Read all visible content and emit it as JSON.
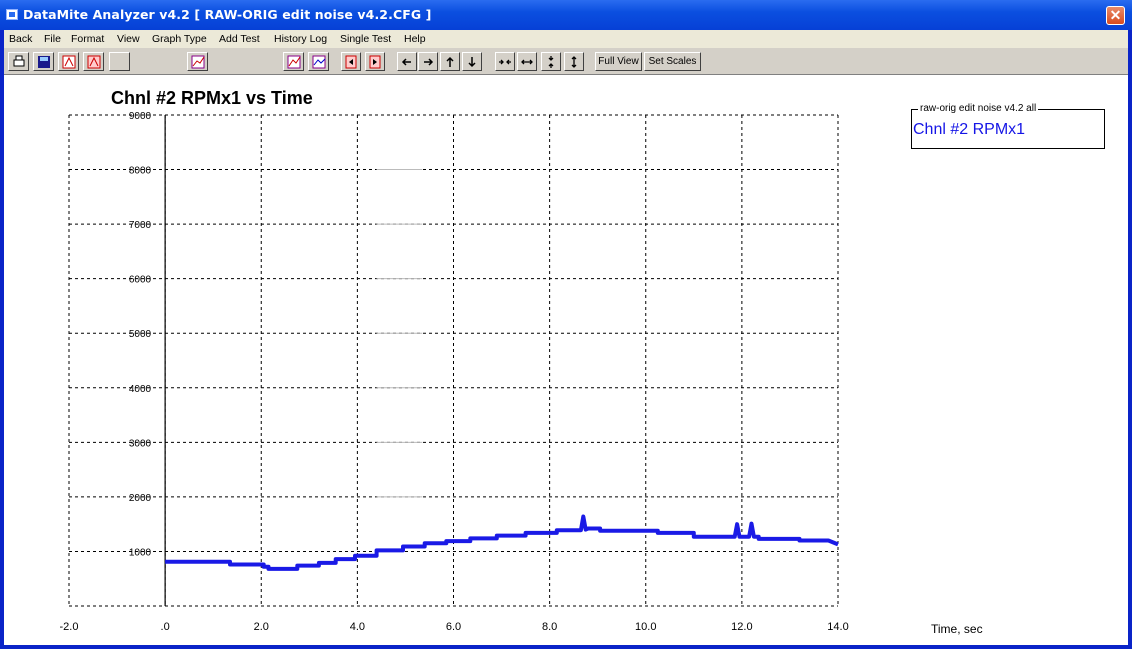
{
  "window": {
    "title": "DataMite Analyzer v4.2  [ RAW-ORIG edit noise v4.2.CFG ]",
    "close_glyph": "✕"
  },
  "menu": [
    "Back",
    "File",
    "Format",
    "View",
    "Graph Type",
    "Add Test",
    "History Log",
    "Single Test",
    "Help"
  ],
  "toolbar": {
    "icons": [
      "printer-icon",
      "save-icon",
      "chart-red-a-icon",
      "chart-red-b-icon",
      "blank-icon",
      "graph-type-icon",
      "zoom-graph-icon",
      "overlay-graph-icon",
      "page-left-icon",
      "page-right-icon",
      "arrow-left-icon",
      "arrow-right-icon",
      "arrow-up-icon",
      "arrow-down-icon",
      "compress-horizontal-icon",
      "expand-horizontal-icon",
      "compress-vertical-icon",
      "expand-vertical-icon"
    ],
    "full_view_label": "Full View",
    "set_scales_label": "Set Scales"
  },
  "legend": {
    "caption": "raw-orig edit noise v4.2   all",
    "series_label": "Chnl #2 RPMx1"
  },
  "chart_data": {
    "type": "line",
    "title": "Chnl #2 RPMx1 vs Time",
    "xlabel": "Time, sec",
    "ylabel": "",
    "xlim": [
      -2.0,
      14.0
    ],
    "ylim": [
      0,
      9000
    ],
    "x_ticks": [
      "-2.0",
      ".0",
      "2.0",
      "4.0",
      "6.0",
      "8.0",
      "10.0",
      "12.0",
      "14.0"
    ],
    "y_ticks": [
      "1000",
      "2000",
      "3000",
      "4000",
      "5000",
      "6000",
      "7000",
      "8000",
      "9000"
    ],
    "grid": true,
    "line_color": "#1a1ae6",
    "series": [
      {
        "name": "Chnl #2 RPMx1",
        "x": [
          0.0,
          1.35,
          1.35,
          2.05,
          2.05,
          2.15,
          2.15,
          2.75,
          2.75,
          3.2,
          3.2,
          3.55,
          3.55,
          3.95,
          3.95,
          4.4,
          4.4,
          4.95,
          4.95,
          5.4,
          5.4,
          5.85,
          5.85,
          6.35,
          6.35,
          6.9,
          6.9,
          7.5,
          7.5,
          8.15,
          8.15,
          8.65,
          8.7,
          8.75,
          8.8,
          9.05,
          9.05,
          10.25,
          10.25,
          11.0,
          11.0,
          11.85,
          11.9,
          11.95,
          12.0,
          12.15,
          12.2,
          12.25,
          12.35,
          12.35,
          13.2,
          13.2,
          13.8,
          14.0
        ],
        "y": [
          810,
          810,
          760,
          760,
          720,
          720,
          680,
          680,
          740,
          740,
          790,
          790,
          860,
          860,
          920,
          920,
          1020,
          1020,
          1090,
          1090,
          1150,
          1150,
          1190,
          1190,
          1240,
          1240,
          1290,
          1290,
          1340,
          1340,
          1390,
          1390,
          1640,
          1400,
          1420,
          1420,
          1380,
          1380,
          1340,
          1340,
          1270,
          1270,
          1500,
          1270,
          1270,
          1270,
          1510,
          1270,
          1270,
          1230,
          1230,
          1200,
          1200,
          1130
        ]
      }
    ],
    "ghost_tick_labels": [
      "8000",
      "7000",
      "6000",
      "5000",
      "4000",
      "3000",
      "2000"
    ]
  }
}
